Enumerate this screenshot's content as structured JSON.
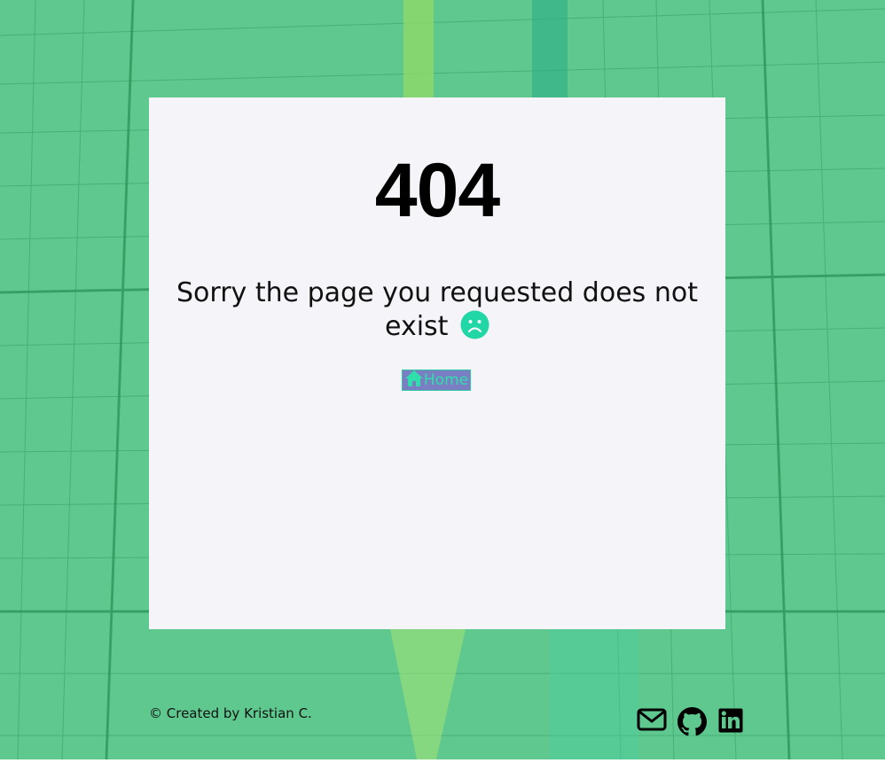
{
  "error": {
    "code": "404",
    "message": "Sorry the page you requested does not exist"
  },
  "home_link": {
    "label": "Home"
  },
  "footer": {
    "credit": "© Created by Kristian C."
  },
  "icons": {
    "sad_face": "sad-face-icon",
    "home": "home-icon",
    "mail": "envelope-icon",
    "github": "github-icon",
    "linkedin": "linkedin-icon"
  },
  "colors": {
    "background": "#5ec88e",
    "card": "#f5f4f9",
    "accent": "#2edfab",
    "home_bg": "#7a7ec2"
  }
}
